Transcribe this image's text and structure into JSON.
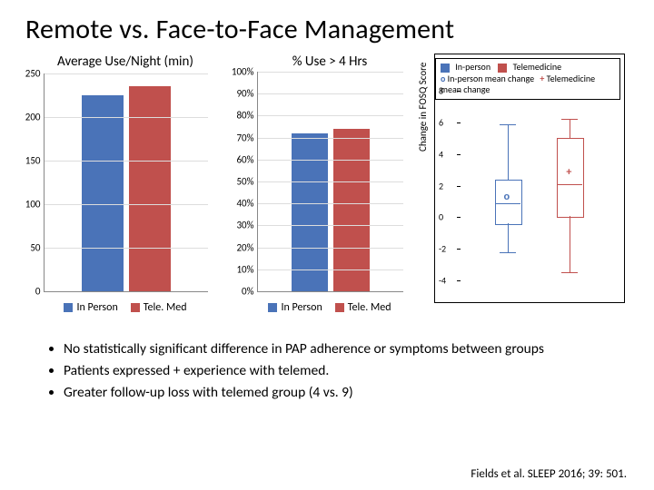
{
  "title": "Remote vs. Face-to-Face Management",
  "colors": {
    "inperson": "#4a73b8",
    "telemed": "#c0504d"
  },
  "legend": {
    "inperson": "In Person",
    "telemed": "Tele. Med"
  },
  "chart_data": [
    {
      "type": "bar",
      "title": "Average Use/Night (min)",
      "ylabel": "",
      "ylim": [
        0,
        250
      ],
      "yticks": [
        0,
        50,
        100,
        150,
        200,
        250
      ],
      "categories": [
        "In Person",
        "Tele. Med"
      ],
      "values": [
        225,
        235
      ]
    },
    {
      "type": "bar",
      "title": "% Use > 4 Hrs",
      "ylabel": "",
      "ylim": [
        0,
        100
      ],
      "yticks": [
        "0%",
        "10%",
        "20%",
        "30%",
        "40%",
        "50%",
        "60%",
        "70%",
        "80%",
        "90%",
        "100%"
      ],
      "categories": [
        "In Person",
        "Tele. Med"
      ],
      "values": [
        72,
        74
      ]
    },
    {
      "type": "boxplot",
      "title": "",
      "ylabel": "Change in FOSQ Score",
      "ylim": [
        -4,
        8
      ],
      "yticks": [
        -4,
        -2,
        0,
        2,
        4,
        6,
        8
      ],
      "legend": {
        "ip": "In-person",
        "tm": "Telemedicine",
        "ipm": "In-person mean change",
        "tmm": "Telemedicine mean change"
      },
      "series": [
        {
          "name": "In-person",
          "color": "#4a73b8",
          "min": -2.2,
          "q1": -0.4,
          "median": 0.9,
          "q3": 2.4,
          "max": 5.9,
          "mean": 1.2,
          "mean_symbol": "o"
        },
        {
          "name": "Telemedicine",
          "color": "#c0504d",
          "min": -3.5,
          "q1": 0.1,
          "median": 2.1,
          "q3": 5.0,
          "max": 6.2,
          "mean": 2.8,
          "mean_symbol": "+"
        }
      ]
    }
  ],
  "bullets": [
    "No statistically significant difference in PAP adherence or symptoms between groups",
    "Patients expressed + experience with telemed.",
    "Greater follow-up loss with telemed group (4 vs. 9)"
  ],
  "citation": "Fields et al. SLEEP 2016; 39: 501."
}
